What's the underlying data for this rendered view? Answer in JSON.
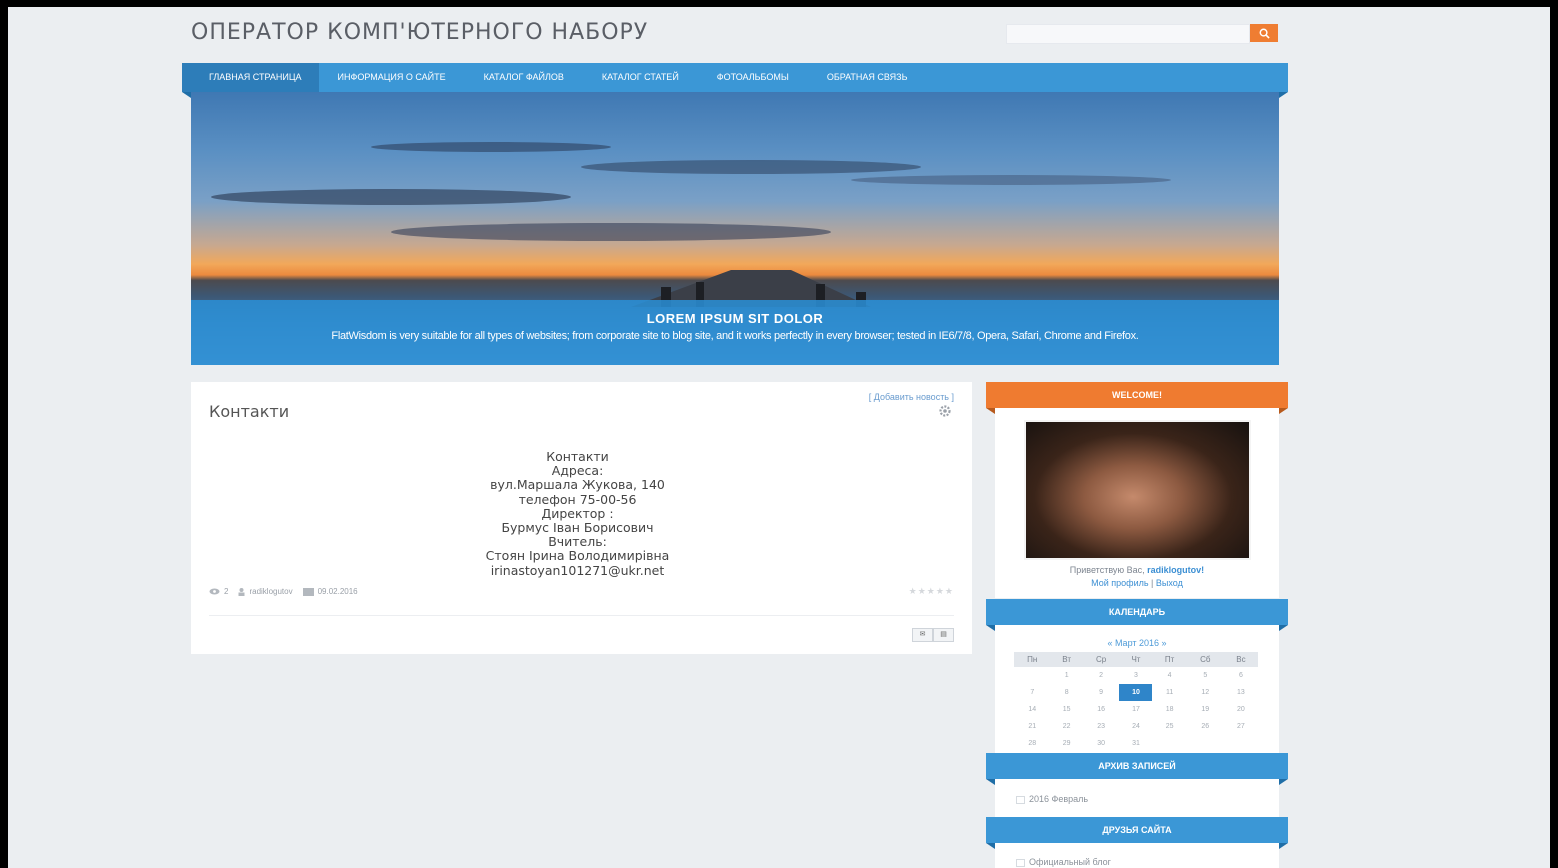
{
  "site": {
    "title": "ОПЕРАТОР КОМП'ЮТЕРНОГО НАБОРУ",
    "search_placeholder": ""
  },
  "nav": {
    "items": [
      {
        "label": "ГЛАВНАЯ СТРАНИЦА",
        "active": true
      },
      {
        "label": "ИНФОРМАЦИЯ О САЙТЕ"
      },
      {
        "label": "КАТАЛОГ ФАЙЛОВ"
      },
      {
        "label": "КАТАЛОГ СТАТЕЙ"
      },
      {
        "label": "ФОТОАЛЬБОМЫ"
      },
      {
        "label": "ОБРАТНАЯ СВЯЗЬ"
      }
    ]
  },
  "banner": {
    "title": "LOREM IPSUM SIT DOLOR",
    "text": "FlatWisdom is very suitable for all types of websites; from corporate site to blog site, and it works perfectly in every browser; tested in IE6/7/8, Opera, Safari, Chrome and Firefox."
  },
  "content": {
    "add_news": "[ Добавить новость ]",
    "title": "Контакти",
    "lines": [
      "Контакти",
      "Адреса:",
      "вул.Маршала Жукова, 140",
      "телефон 75-00-56",
      "Директор :",
      "Бурмус Іван Борисович",
      "Вчитель:",
      "Стоян Ірина Володимирівна",
      "irinastoyan101271@ukr.net"
    ],
    "meta": {
      "views": "2",
      "author": "radiklogutov",
      "date": "09.02.2016"
    },
    "stars": "★★★★★"
  },
  "sidebar": {
    "welcome_title": "WELCOME!",
    "greeting_prefix": "Приветствую Вас, ",
    "username": "radiklogutov!",
    "profile_link": "Мой профиль",
    "separator": " | ",
    "logout_link": "Выход",
    "calendar_title": "КАЛЕНДАРЬ",
    "calendar_month": "«  Март 2016  »",
    "calendar_days": [
      "Пн",
      "Вт",
      "Ср",
      "Чт",
      "Пт",
      "Сб",
      "Вс"
    ],
    "calendar_weeks": [
      [
        "",
        "1",
        "2",
        "3",
        "4",
        "5",
        "6"
      ],
      [
        "7",
        "8",
        "9",
        "10",
        "11",
        "12",
        "13"
      ],
      [
        "14",
        "15",
        "16",
        "17",
        "18",
        "19",
        "20"
      ],
      [
        "21",
        "22",
        "23",
        "24",
        "25",
        "26",
        "27"
      ],
      [
        "28",
        "29",
        "30",
        "31",
        "",
        "",
        ""
      ]
    ],
    "calendar_today": "10",
    "archive_title": "АРХИВ ЗАПИСЕЙ",
    "archive_item": "2016 Февраль",
    "friends_title": "ДРУЗЬЯ САЙТА",
    "friends_item": "Официальный блог"
  },
  "colors": {
    "accent_blue": "#3b97d6",
    "accent_orange": "#ef7b30",
    "link": "#3c8fd3"
  },
  "icons": {
    "search": "search-icon",
    "gear": "gear-icon",
    "views": "eye-icon",
    "author": "user-icon",
    "date": "calendar-icon"
  }
}
